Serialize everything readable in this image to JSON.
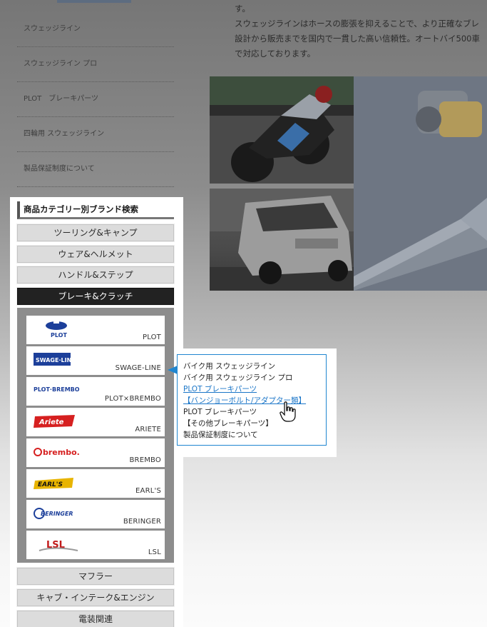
{
  "top_nav": {
    "items": [
      {
        "label": "スウェッジライン"
      },
      {
        "label": "スウェッジライン プロ"
      },
      {
        "label": "PLOT　ブレーキパーツ"
      },
      {
        "label": "四輪用 スウェッジライン"
      },
      {
        "label": "製品保証制度について"
      }
    ]
  },
  "description": {
    "lines": [
      "す。",
      "スウェッジラインはホースの膨張を抑えることで、より正確なブレ",
      "設計から販売までを国内で一貫した高い信頼性。オートバイ500車",
      "で対応しております。"
    ]
  },
  "category_panel": {
    "title": "商品カテゴリー別ブランド検索",
    "categories_top": [
      {
        "label": "ツーリング&キャンプ"
      },
      {
        "label": "ウェア&ヘルメット"
      },
      {
        "label": "ハンドル&ステップ"
      },
      {
        "label": "ブレーキ&クラッチ",
        "active": true
      }
    ],
    "brands": [
      {
        "name": "PLOT",
        "logo_text": "PLOT",
        "icon": "plot-logo"
      },
      {
        "name": "SWAGE-LINE",
        "logo_text": "SWAGE·LINE",
        "icon": "swage-line-logo"
      },
      {
        "name": "PLOT×BREMBO",
        "logo_text": "PLOT·BREMBO",
        "icon": "plot-brembo-logo"
      },
      {
        "name": "ARIETE",
        "logo_text": "Ariete",
        "icon": "ariete-logo"
      },
      {
        "name": "BREMBO",
        "logo_text": "brembo.",
        "icon": "brembo-logo"
      },
      {
        "name": "EARL'S",
        "logo_text": "EARL'S",
        "icon": "earls-logo"
      },
      {
        "name": "BERINGER",
        "logo_text": "BERINGER",
        "icon": "beringer-logo"
      },
      {
        "name": "LSL",
        "logo_text": "LSL",
        "icon": "lsl-logo"
      }
    ],
    "categories_bottom": [
      {
        "label": "マフラー"
      },
      {
        "label": "キャブ・インテーク&エンジン"
      },
      {
        "label": "電装関連"
      }
    ]
  },
  "popup": {
    "links": [
      {
        "label": "バイク用 スウェッジライン",
        "hover": false
      },
      {
        "label": "バイク用 スウェッジライン プロ",
        "hover": false
      },
      {
        "label": "PLOT ブレーキパーツ",
        "hover": true
      },
      {
        "label": "【バンジョーボルト/アダプター類】",
        "hover": true
      },
      {
        "label": "PLOT ブレーキパーツ",
        "hover": false
      },
      {
        "label": "【その他ブレーキパーツ】",
        "hover": false
      },
      {
        "label": "製品保証制度について",
        "hover": false
      }
    ],
    "accent_color": "#1f86d0"
  },
  "colors": {
    "link": "#1b76c8",
    "active_category_bg": "#222222"
  }
}
